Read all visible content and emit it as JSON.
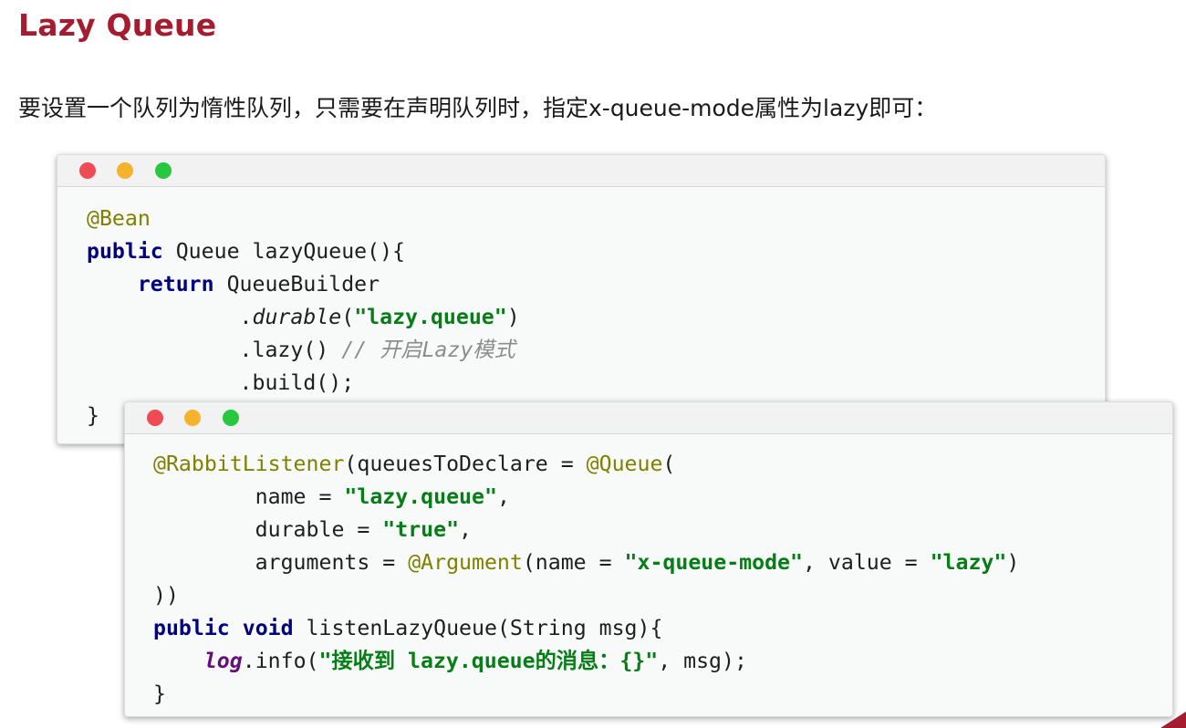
{
  "page": {
    "title": "Lazy Queue",
    "intro": "要设置一个队列为惰性队列，只需要在声明队列时，指定x-queue-mode属性为lazy即可："
  },
  "colors": {
    "title": "#a51c30",
    "window_bg": "#f8faf9",
    "titlebar_bg": "#f2f2f2",
    "dot_red": "#ee4b52",
    "dot_yellow": "#f5b22c",
    "dot_green": "#27c840",
    "keyword": "#000080",
    "annotation": "#808000",
    "string": "#067d17",
    "comment": "#8c8c8c",
    "field": "#660e7a"
  },
  "code_windows": [
    {
      "window_controls": [
        "close-dot",
        "minimize-dot",
        "maximize-dot"
      ],
      "lines": [
        [
          {
            "t": "@Bean",
            "k": "ann"
          }
        ],
        [
          {
            "t": "public",
            "k": "kw"
          },
          {
            "t": " Queue lazyQueue(){",
            "k": "plain"
          }
        ],
        [
          {
            "t": "    ",
            "k": "plain"
          },
          {
            "t": "return",
            "k": "kw"
          },
          {
            "t": " QueueBuilder",
            "k": "plain"
          }
        ],
        [
          {
            "t": "            .",
            "k": "plain"
          },
          {
            "t": "durable",
            "k": "ital"
          },
          {
            "t": "(",
            "k": "plain"
          },
          {
            "t": "\"lazy.queue\"",
            "k": "str"
          },
          {
            "t": ")",
            "k": "plain"
          }
        ],
        [
          {
            "t": "            .lazy() ",
            "k": "plain"
          },
          {
            "t": "// 开启Lazy模式",
            "k": "cmt"
          }
        ],
        [
          {
            "t": "            .build();",
            "k": "plain"
          }
        ],
        [
          {
            "t": "}",
            "k": "plain"
          }
        ]
      ]
    },
    {
      "window_controls": [
        "close-dot",
        "minimize-dot",
        "maximize-dot"
      ],
      "lines": [
        [
          {
            "t": "@RabbitListener",
            "k": "ann"
          },
          {
            "t": "(queuesToDeclare = ",
            "k": "plain"
          },
          {
            "t": "@Queue",
            "k": "ann"
          },
          {
            "t": "(",
            "k": "plain"
          }
        ],
        [
          {
            "t": "        name = ",
            "k": "plain"
          },
          {
            "t": "\"lazy.queue\"",
            "k": "str"
          },
          {
            "t": ",",
            "k": "plain"
          }
        ],
        [
          {
            "t": "        durable = ",
            "k": "plain"
          },
          {
            "t": "\"true\"",
            "k": "str"
          },
          {
            "t": ",",
            "k": "plain"
          }
        ],
        [
          {
            "t": "        arguments = ",
            "k": "plain"
          },
          {
            "t": "@Argument",
            "k": "ann"
          },
          {
            "t": "(name = ",
            "k": "plain"
          },
          {
            "t": "\"x-queue-mode\"",
            "k": "str"
          },
          {
            "t": ", value = ",
            "k": "plain"
          },
          {
            "t": "\"lazy\"",
            "k": "str"
          },
          {
            "t": ")",
            "k": "plain"
          }
        ],
        [
          {
            "t": "))",
            "k": "plain"
          }
        ],
        [
          {
            "t": "public",
            "k": "kw"
          },
          {
            "t": " ",
            "k": "plain"
          },
          {
            "t": "void",
            "k": "kw"
          },
          {
            "t": " listenLazyQueue(String msg){",
            "k": "plain"
          }
        ],
        [
          {
            "t": "    ",
            "k": "plain"
          },
          {
            "t": "log",
            "k": "field"
          },
          {
            "t": ".info(",
            "k": "plain"
          },
          {
            "t": "\"接收到 lazy.queue的消息：{}\"",
            "k": "str"
          },
          {
            "t": ", msg);",
            "k": "plain"
          }
        ],
        [
          {
            "t": "}",
            "k": "plain"
          }
        ]
      ]
    }
  ]
}
